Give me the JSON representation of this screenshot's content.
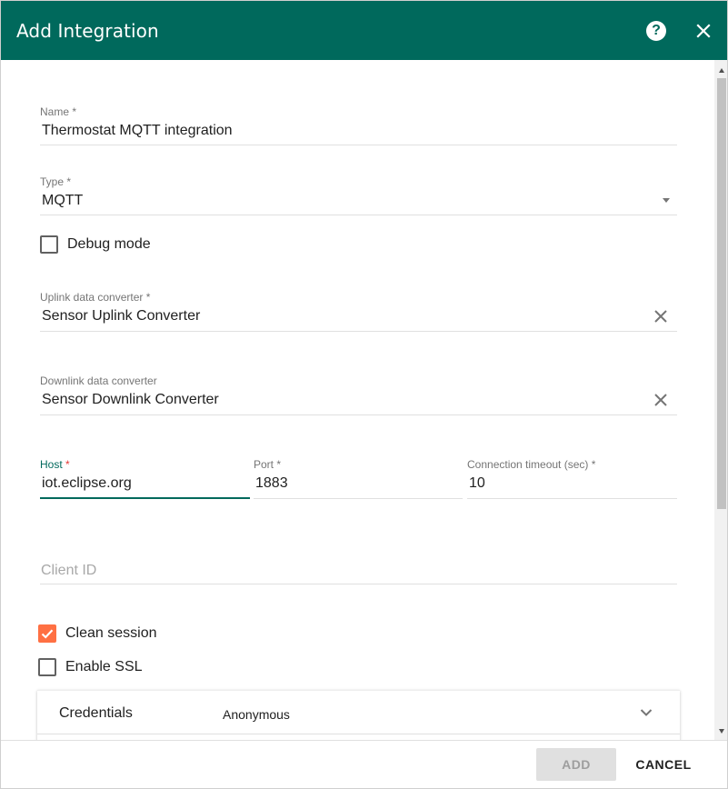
{
  "dialog": {
    "title": "Add Integration",
    "help_icon": "help-circle-icon",
    "close_icon": "close-icon"
  },
  "form": {
    "name": {
      "label": "Name",
      "required_mark": "*",
      "value": "Thermostat MQTT integration"
    },
    "type": {
      "label": "Type",
      "required_mark": "*",
      "value": "MQTT"
    },
    "debug_mode": {
      "label": "Debug mode",
      "checked": false
    },
    "uplink_converter": {
      "label": "Uplink data converter",
      "required_mark": "*",
      "value": "Sensor Uplink Converter"
    },
    "downlink_converter": {
      "label": "Downlink data converter",
      "value": "Sensor Downlink Converter"
    },
    "host": {
      "label": "Host",
      "required_mark": "*",
      "value": "iot.eclipse.org"
    },
    "port": {
      "label": "Port",
      "required_mark": "*",
      "value": "1883"
    },
    "timeout": {
      "label": "Connection timeout (sec)",
      "required_mark": "*",
      "value": "10"
    },
    "client_id": {
      "placeholder": "Client ID",
      "value": ""
    },
    "clean_session": {
      "label": "Clean session",
      "checked": true
    },
    "enable_ssl": {
      "label": "Enable SSL",
      "checked": false
    },
    "credentials": {
      "title": "Credentials",
      "value": "Anonymous"
    }
  },
  "footer": {
    "add_label": "ADD",
    "cancel_label": "CANCEL"
  },
  "colors": {
    "header": "#00695c",
    "accent": "#ff7043",
    "required_active": "#e53935"
  }
}
